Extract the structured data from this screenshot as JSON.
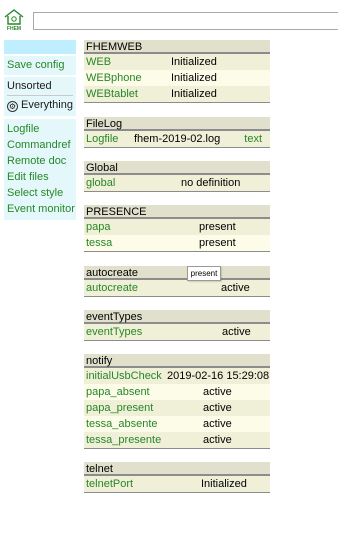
{
  "header": {
    "logo_text": "FHEM",
    "command_value": ""
  },
  "menu": {
    "save_config": "Save config",
    "rooms": [
      {
        "label": "Unsorted"
      },
      {
        "label": "Everything"
      }
    ],
    "links": [
      {
        "label": "Logfile"
      },
      {
        "label": "Commandref"
      },
      {
        "label": "Remote doc"
      },
      {
        "label": "Edit files"
      },
      {
        "label": "Select style"
      },
      {
        "label": "Event monitor"
      }
    ]
  },
  "rooms": [
    {
      "title": "FHEMWEB",
      "devices": [
        {
          "name": "WEB",
          "state": "Initialized"
        },
        {
          "name": "WEBphone",
          "state": "Initialized"
        },
        {
          "name": "WEBtablet",
          "state": "Initialized"
        }
      ]
    },
    {
      "title": "FileLog",
      "devices": [
        {
          "name": "Logfile",
          "state": "fhem-2019-02.log",
          "extra": "text"
        }
      ]
    },
    {
      "title": "Global",
      "devices": [
        {
          "name": "global",
          "state": "no definition"
        }
      ]
    },
    {
      "title": "PRESENCE",
      "devices": [
        {
          "name": "papa",
          "state": "present"
        },
        {
          "name": "tessa",
          "state": "present"
        }
      ]
    },
    {
      "title": "autocreate",
      "devices": [
        {
          "name": "autocreate",
          "state": "active"
        }
      ]
    },
    {
      "title": "eventTypes",
      "devices": [
        {
          "name": "eventTypes",
          "state": "active"
        }
      ]
    },
    {
      "title": "notify",
      "devices": [
        {
          "name": "initialUsbCheck",
          "state": "2019-02-16 15:29:08"
        },
        {
          "name": "papa_absent",
          "state": "active"
        },
        {
          "name": "papa_present",
          "state": "active"
        },
        {
          "name": "tessa_absente",
          "state": "active"
        },
        {
          "name": "tessa_presente",
          "state": "active"
        }
      ]
    },
    {
      "title": "telnet",
      "devices": [
        {
          "name": "telnetPort",
          "state": "Initialized"
        }
      ]
    }
  ],
  "tooltip": "present"
}
